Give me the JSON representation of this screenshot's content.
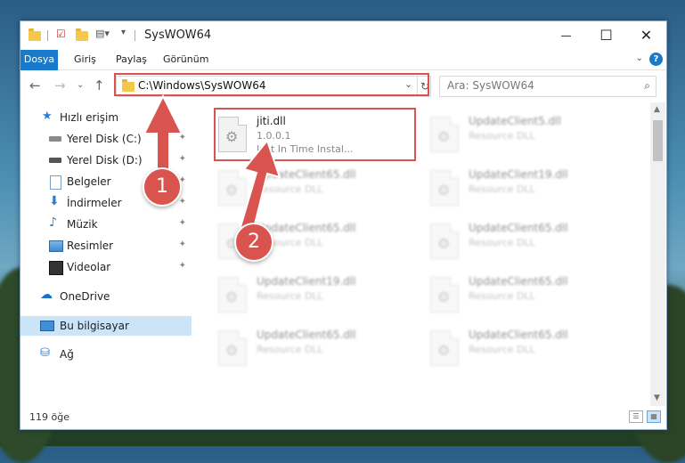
{
  "window": {
    "title": "SysWOW64",
    "controls": {
      "minimize": "—",
      "maximize": "☐",
      "close": "✕"
    }
  },
  "ribbon": {
    "tabs": [
      {
        "label": "Dosya",
        "active": true
      },
      {
        "label": "Giriş"
      },
      {
        "label": "Paylaş"
      },
      {
        "label": "Görünüm"
      }
    ],
    "help": "?"
  },
  "navigation": {
    "address": "C:\\Windows\\SysWOW64",
    "search_placeholder": "Ara: SysWOW64"
  },
  "sidebar": {
    "items": [
      {
        "label": "Hızlı erişim",
        "icon": "star-icon"
      },
      {
        "label": "Yerel Disk (C:)",
        "icon": "drive-icon",
        "pinned": true
      },
      {
        "label": "Yerel Disk (D:)",
        "icon": "drive-icon",
        "pinned": true
      },
      {
        "label": "Belgeler",
        "icon": "documents-icon",
        "pinned": true
      },
      {
        "label": "İndirmeler",
        "icon": "download-icon",
        "pinned": true
      },
      {
        "label": "Müzik",
        "icon": "music-icon",
        "pinned": true
      },
      {
        "label": "Resimler",
        "icon": "pictures-icon",
        "pinned": true
      },
      {
        "label": "Videolar",
        "icon": "videos-icon",
        "pinned": true
      },
      {
        "label": "OneDrive",
        "icon": "cloud-icon"
      },
      {
        "label": "Bu bilgisayar",
        "icon": "computer-icon",
        "selected": true
      },
      {
        "label": "Ağ",
        "icon": "network-icon"
      }
    ]
  },
  "files": [
    {
      "name": "jiti.dll",
      "line1": "1.0.0.1",
      "line2": "Just In Time Instal...",
      "highlighted": true
    },
    {
      "name": "UpdateClient5.dll",
      "line1": "Resource DLL",
      "blurred": true
    },
    {
      "name": "UpdateClient65.dll",
      "line1": "Resource DLL",
      "blurred": true
    },
    {
      "name": "UpdateClient19.dll",
      "line1": "Resource DLL",
      "blurred": true
    },
    {
      "name": "UpdateClient65.dll",
      "line1": "Resource DLL",
      "blurred": true
    },
    {
      "name": "UpdateClient65.dll",
      "line1": "Resource DLL",
      "blurred": true
    },
    {
      "name": "UpdateClient19.dll",
      "line1": "Resource DLL",
      "blurred": true
    },
    {
      "name": "UpdateClient65.dll",
      "line1": "Resource DLL",
      "blurred": true
    },
    {
      "name": "UpdateClient65.dll",
      "line1": "Resource DLL",
      "blurred": true
    },
    {
      "name": "UpdateClient65.dll",
      "line1": "Resource DLL",
      "blurred": true
    }
  ],
  "status": {
    "item_count": "119 öğe"
  },
  "annotations": {
    "step1": "1",
    "step2": "2"
  },
  "colors": {
    "accent": "#1979ca",
    "highlight": "#d9534f",
    "selected": "#cce4f7"
  }
}
